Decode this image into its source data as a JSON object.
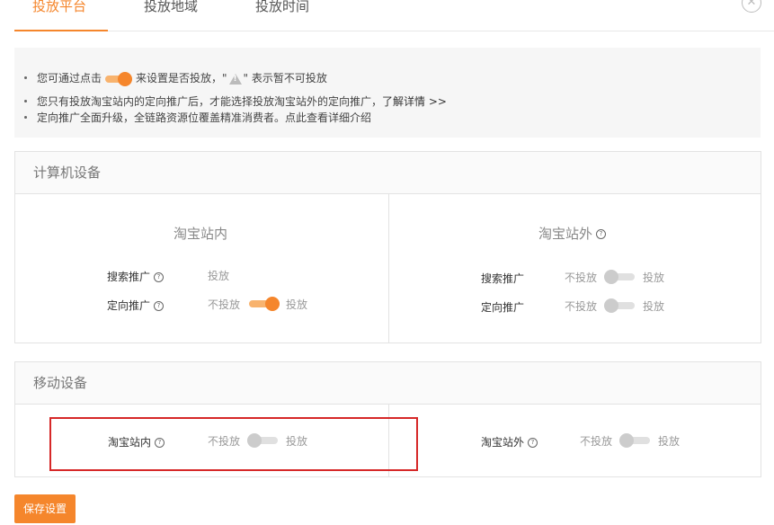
{
  "tabs": [
    {
      "label": "投放平台",
      "active": true
    },
    {
      "label": "投放地域",
      "active": false
    },
    {
      "label": "投放时间",
      "active": false
    }
  ],
  "notice": {
    "line1_a": "您可通过点击",
    "line1_b": "来设置是否投放，\"",
    "line1_c": "\" 表示暂不可投放",
    "line2_a": "您只有投放淘宝站内的定向推广后，才能选择投放淘宝站外的定向推广，",
    "line2_link": "了解详情 >>",
    "line3": "定向推广全面升级，全链路资源位覆盖精准消费者。点此查看详细介绍"
  },
  "computer": {
    "title": "计算机设备",
    "inside": {
      "title": "淘宝站内",
      "search_label": "搜索推广",
      "search_value": "投放",
      "targeted_label": "定向推广",
      "targeted_off": "不投放",
      "targeted_on": "投放"
    },
    "outside": {
      "title": "淘宝站外",
      "search_label": "搜索推广",
      "search_off": "不投放",
      "search_on": "投放",
      "targeted_label": "定向推广",
      "targeted_off": "不投放",
      "targeted_on": "投放"
    }
  },
  "mobile": {
    "title": "移动设备",
    "inside_label": "淘宝站内",
    "inside_off": "不投放",
    "inside_on": "投放",
    "outside_label": "淘宝站外",
    "outside_off": "不投放",
    "outside_on": "投放"
  },
  "save_label": "保存设置",
  "colors": {
    "accent": "#f5862c",
    "highlight": "#d62828"
  }
}
